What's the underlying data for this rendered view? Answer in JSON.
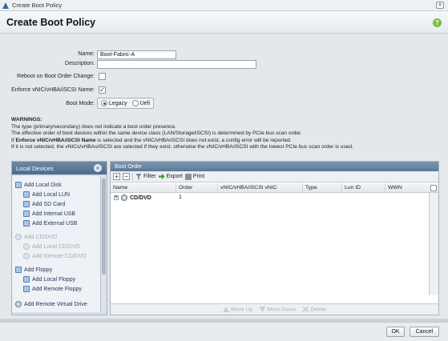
{
  "window": {
    "title": "Create Boot Policy",
    "close_glyph": "×"
  },
  "header": {
    "title": "Create Boot Policy",
    "help_glyph": "?"
  },
  "form": {
    "name_label": "Name:",
    "name_value": "Boot-Fabric-A",
    "description_label": "Description:",
    "description_value": "",
    "reboot_label": "Reboot on Boot Order Change:",
    "reboot_checked": false,
    "enforce_label": "Enforce vNIC/vHBA/iSCSI Name:",
    "enforce_checked": true,
    "check_glyph": "✓",
    "boot_mode_label": "Boot Mode:",
    "boot_mode_options": [
      "Legacy",
      "Uefi"
    ],
    "boot_mode_selected": "Legacy"
  },
  "warnings": {
    "title": "WARNINGS:",
    "line1": "The type (primary/secondary) does not indicate a boot order presence.",
    "line2": "The effective order of boot devices within the same device class (LAN/Storage/iSCSI) is determined by PCIe bus scan order.",
    "line3_prefix": "If ",
    "line3_bold": "Enforce vNIC/vHBA/iSCSI Name",
    "line3_suffix": " is selected and the vNIC/vHBA/iSCSI does not exist, a config error will be reported.",
    "line4": "If it is not selected, the vNICs/vHBAs/iSCSI are selected if they exist, otherwise the vNIC/vHBA/iSCSI with the lowest PCIe bus scan order is used."
  },
  "local_devices": {
    "title": "Local Devices",
    "collapse_glyph": "«",
    "items": [
      {
        "label": "Add Local Disk",
        "level": 0,
        "enabled": true,
        "icon": "disk-icon"
      },
      {
        "label": "Add Local LUN",
        "level": 1,
        "enabled": true,
        "icon": "lun-icon"
      },
      {
        "label": "Add SD Card",
        "level": 1,
        "enabled": true,
        "icon": "sd-card-icon"
      },
      {
        "label": "Add Internal USB",
        "level": 1,
        "enabled": true,
        "icon": "usb-icon"
      },
      {
        "label": "Add External USB",
        "level": 1,
        "enabled": true,
        "icon": "usb-icon"
      },
      {
        "label": "Add CD/DVD",
        "level": 0,
        "enabled": false,
        "icon": "cd-icon"
      },
      {
        "label": "Add Local CD/DVD",
        "level": 1,
        "enabled": false,
        "icon": "cd-icon"
      },
      {
        "label": "Add Remote CD/DVD",
        "level": 1,
        "enabled": false,
        "icon": "cd-icon"
      },
      {
        "label": "Add Floppy",
        "level": 0,
        "enabled": true,
        "icon": "floppy-icon"
      },
      {
        "label": "Add Local Floppy",
        "level": 1,
        "enabled": true,
        "icon": "floppy-icon"
      },
      {
        "label": "Add Remote Floppy",
        "level": 1,
        "enabled": true,
        "icon": "floppy-icon"
      },
      {
        "label": "Add Remote Virtual Drive",
        "level": 0,
        "enabled": true,
        "icon": "virtual-drive-icon"
      }
    ]
  },
  "boot_order": {
    "title": "Boot Order",
    "toolbar": {
      "add_glyph": "+",
      "remove_glyph": "−",
      "filter": "Filter",
      "export": "Export",
      "print": "Print"
    },
    "columns": [
      "Name",
      "Order",
      "vNIC/vHBA/iSCSI vNIC",
      "Type",
      "Lun ID",
      "WWN"
    ],
    "rows": [
      {
        "expander": "+",
        "name": "CD/DVD",
        "order": "1",
        "vnic": "",
        "type": "",
        "lun": "",
        "wwn": ""
      }
    ],
    "actions": {
      "move_up": "Move Up",
      "move_down": "Move Down",
      "delete": "Delete"
    }
  },
  "footer": {
    "ok": "OK",
    "cancel": "Cancel"
  }
}
